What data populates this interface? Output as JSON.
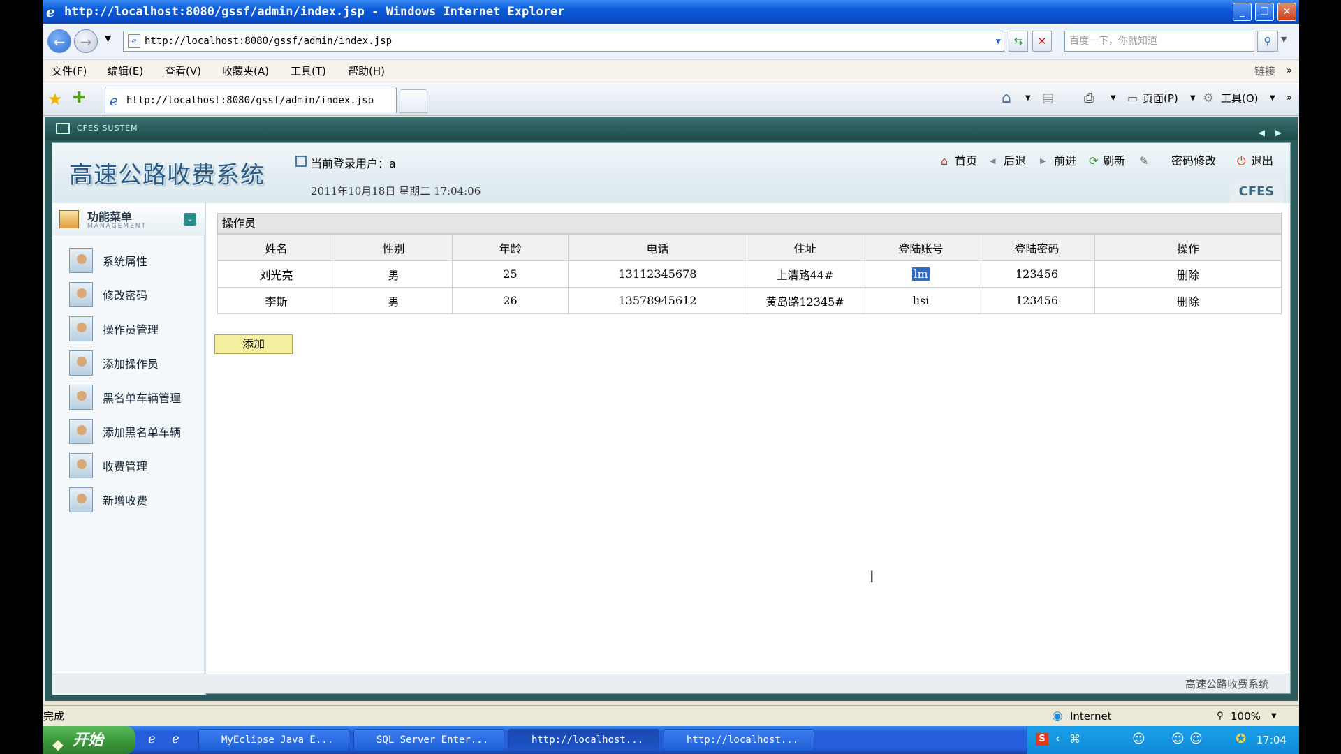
{
  "window": {
    "title": "http://localhost:8080/gssf/admin/index.jsp - Windows Internet Explorer"
  },
  "address_bar": {
    "url": "http://localhost:8080/gssf/admin/index.jsp",
    "search_placeholder": "百度一下，你就知道"
  },
  "menu": {
    "items": [
      "文件(F)",
      "编辑(E)",
      "查看(V)",
      "收藏夹(A)",
      "工具(T)",
      "帮助(H)"
    ],
    "links_label": "链接"
  },
  "tabs": {
    "active_tab": "http://localhost:8080/gssf/admin/index.jsp"
  },
  "command_bar": {
    "page_label": "页面(P)",
    "tools_label": "工具(O)"
  },
  "app": {
    "strip_label": "CFES SUSTEM",
    "logo_title": "高速公路收费系统",
    "current_user_label": "当前登录用户：a",
    "date_text": "2011年10月18日 星期二 17:04:06",
    "header_links": {
      "home": "首页",
      "back": "后退",
      "forward": "前进",
      "refresh": "刷新",
      "change_password": "密码修改",
      "logout": "退出"
    },
    "badge": "CFES",
    "footer": "高速公路收费系统"
  },
  "sidebar": {
    "title": "功能菜单",
    "subtitle": "MANAGEMENT",
    "items": [
      {
        "label": "系统属性"
      },
      {
        "label": "修改密码"
      },
      {
        "label": "操作员管理"
      },
      {
        "label": "添加操作员"
      },
      {
        "label": "黑名单车辆管理"
      },
      {
        "label": "添加黑名单车辆"
      },
      {
        "label": "收费管理"
      },
      {
        "label": "新增收费"
      }
    ]
  },
  "operators": {
    "section_title": "操作员",
    "columns": [
      "姓名",
      "性别",
      "年龄",
      "电话",
      "住址",
      "登陆账号",
      "登陆密码",
      "操作"
    ],
    "rows": [
      {
        "name": "刘光亮",
        "gender": "男",
        "age": "25",
        "phone": "13112345678",
        "address": "上清路44#",
        "account": "lm",
        "password": "123456",
        "action": "删除"
      },
      {
        "name": "李斯",
        "gender": "男",
        "age": "26",
        "phone": "13578945612",
        "address": "黄岛路12345#",
        "account": "lisi",
        "password": "123456",
        "action": "删除"
      }
    ],
    "add_button": "添加"
  },
  "status_bar": {
    "status": "完成",
    "zone": "Internet",
    "zoom": "100%"
  },
  "taskbar": {
    "start": "开始",
    "tasks": [
      "MyEclipse Java E...",
      "SQL Server Enter...",
      "http://localhost...",
      "http://localhost..."
    ],
    "clock": "17:04"
  }
}
